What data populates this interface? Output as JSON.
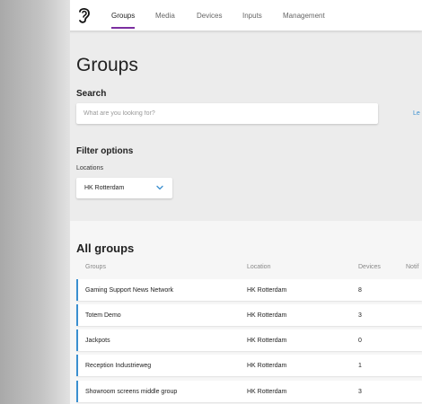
{
  "nav": {
    "tabs": [
      {
        "label": "Groups",
        "active": true
      },
      {
        "label": "Media",
        "active": false
      },
      {
        "label": "Devices",
        "active": false
      },
      {
        "label": "Inputs",
        "active": false
      },
      {
        "label": "Management",
        "active": false
      }
    ],
    "accent_color": "#7b2fa0"
  },
  "page": {
    "title": "Groups"
  },
  "search": {
    "heading": "Search",
    "placeholder": "What are you looking for?",
    "value": "",
    "side_link_partial": "Le"
  },
  "filters": {
    "heading": "Filter options",
    "locations_label": "Locations",
    "selected_location": "HK Rotterdam"
  },
  "groups_table": {
    "title": "All groups",
    "columns": [
      "Groups",
      "Location",
      "Devices",
      "Notif"
    ],
    "rows": [
      {
        "name": "Gaming Support News Network",
        "location": "HK Rotterdam",
        "devices": "8"
      },
      {
        "name": "Totem Demo",
        "location": "HK Rotterdam",
        "devices": "3"
      },
      {
        "name": "Jackpots",
        "location": "HK Rotterdam",
        "devices": "0"
      },
      {
        "name": "Reception Industrieweg",
        "location": "HK Rotterdam",
        "devices": "1"
      },
      {
        "name": "Showroom screens middle group",
        "location": "HK Rotterdam",
        "devices": "3"
      }
    ],
    "row_accent_color": "#3a8fd0"
  }
}
